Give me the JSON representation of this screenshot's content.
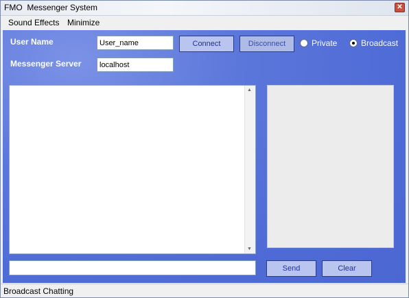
{
  "window": {
    "title": "FMO  Messenger System",
    "close_glyph": "✕"
  },
  "menu": {
    "items": [
      "Sound Effects",
      "Minimize"
    ]
  },
  "form": {
    "user_name_label": "User Name",
    "user_name_value": "User_name",
    "server_label": "Messenger Server",
    "server_value": "localhost"
  },
  "buttons": {
    "connect": "Connect",
    "disconnect": "Disconnect",
    "send": "Send",
    "clear": "Clear"
  },
  "mode": {
    "private_label": "Private",
    "broadcast_label": "Broadcast",
    "selected": "broadcast"
  },
  "scroll": {
    "up_glyph": "▲",
    "down_glyph": "▼"
  },
  "status": {
    "text": "Broadcast Chatting"
  },
  "colors": {
    "panel_blue": "#4f6bd6",
    "button_fill": "#b9c5ee",
    "button_text": "#1c2f9e"
  }
}
